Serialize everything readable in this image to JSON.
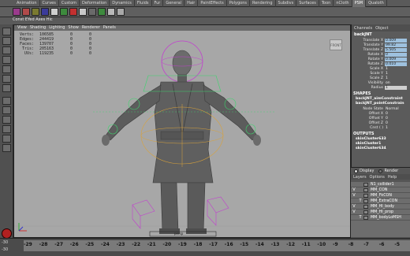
{
  "menu_tabs": [
    "Animation",
    "Curves",
    "Custom",
    "Deformation",
    "Dynamics",
    "Fluids",
    "Fur",
    "General",
    "Hair",
    "PaintEffects",
    "Polygons",
    "Rendering",
    "Subdivs",
    "Surfaces",
    "Toon",
    "nCloth",
    "PSM",
    "Qualoth"
  ],
  "shelf_row2_text": "Const EYed Axes Hic",
  "viewport": {
    "menu": [
      "View",
      "Shading",
      "Lighting",
      "Show",
      "Renderer",
      "Panels"
    ],
    "stats": [
      {
        "label": "Verts:",
        "a": "106585",
        "b": "0",
        "c": "0"
      },
      {
        "label": "Edges:",
        "a": "244419",
        "b": "0",
        "c": "0"
      },
      {
        "label": "Faces:",
        "a": "139707",
        "b": "0",
        "c": "0"
      },
      {
        "label": "Tris:",
        "a": "205163",
        "b": "0",
        "c": "0"
      },
      {
        "label": "UVs:",
        "a": "119235",
        "b": "0",
        "c": "0"
      }
    ],
    "view_cube_label": "FRONT",
    "camera_label": "persp"
  },
  "channel_box": {
    "tabs": [
      "Channels",
      "Object"
    ],
    "node": "backJNT",
    "attributes": [
      {
        "label": "Translate X",
        "value": "0.009",
        "style": "blue"
      },
      {
        "label": "Translate Y",
        "value": "99.82",
        "style": "blue"
      },
      {
        "label": "Translate Z",
        "value": "5.505",
        "style": "blue"
      },
      {
        "label": "Rotate X",
        "value": "0",
        "style": "blue"
      },
      {
        "label": "Rotate Y",
        "value": "0.009",
        "style": "blue"
      },
      {
        "label": "Rotate Z",
        "value": "0.010",
        "style": "blue"
      },
      {
        "label": "Scale X",
        "value": "1",
        "style": "none"
      },
      {
        "label": "Scale Y",
        "value": "1",
        "style": "none"
      },
      {
        "label": "Scale Z",
        "value": "1",
        "style": "none"
      },
      {
        "label": "Visibility",
        "value": "on",
        "style": "none"
      },
      {
        "label": "Radius",
        "value": "1",
        "style": "plain"
      }
    ],
    "shapes_header": "SHAPES",
    "shapes": [
      "backJNT_aimConstraint",
      "backJNT_pointConstrain"
    ],
    "shape_attrs": [
      {
        "label": "Node State",
        "value": "Normal"
      },
      {
        "label": "Offset X",
        "value": "0"
      },
      {
        "label": "Offset Y",
        "value": "0"
      },
      {
        "label": "Offset Z",
        "value": "0"
      },
      {
        "label": "Cnst ( )",
        "value": "1"
      }
    ],
    "outputs_header": "OUTPUTS",
    "outputs": [
      "skinCluster633",
      "skinCluster1",
      "skinCluster634"
    ]
  },
  "layers": {
    "radio": [
      "Display",
      "Render"
    ],
    "menu": [
      "Layers",
      "Options",
      "Help"
    ],
    "items": [
      {
        "v": "",
        "t": "",
        "name": "N1_collider1"
      },
      {
        "v": "V",
        "t": "",
        "name": "MM_CON"
      },
      {
        "v": "V",
        "t": "",
        "name": "MM_FkCON"
      },
      {
        "v": "",
        "t": "T",
        "name": "MM_ExtraCON"
      },
      {
        "v": "V",
        "t": "",
        "name": "MM_HI_body"
      },
      {
        "v": "V",
        "t": "",
        "name": "MM_HI_prop"
      },
      {
        "v": "",
        "t": "T",
        "name": "MM_bodyLoMSH"
      }
    ]
  },
  "timeslider": {
    "start_top": "-30",
    "start_bottom": "-30",
    "ticks": [
      "-29",
      "-28",
      "-27",
      "-26",
      "-25",
      "-24",
      "-23",
      "-22",
      "-21",
      "-20",
      "-19",
      "-18",
      "-17",
      "-16",
      "-15",
      "-14",
      "-13",
      "-12",
      "-11",
      "-10",
      "-9",
      "-8",
      "-7",
      "-6",
      "-5"
    ]
  }
}
